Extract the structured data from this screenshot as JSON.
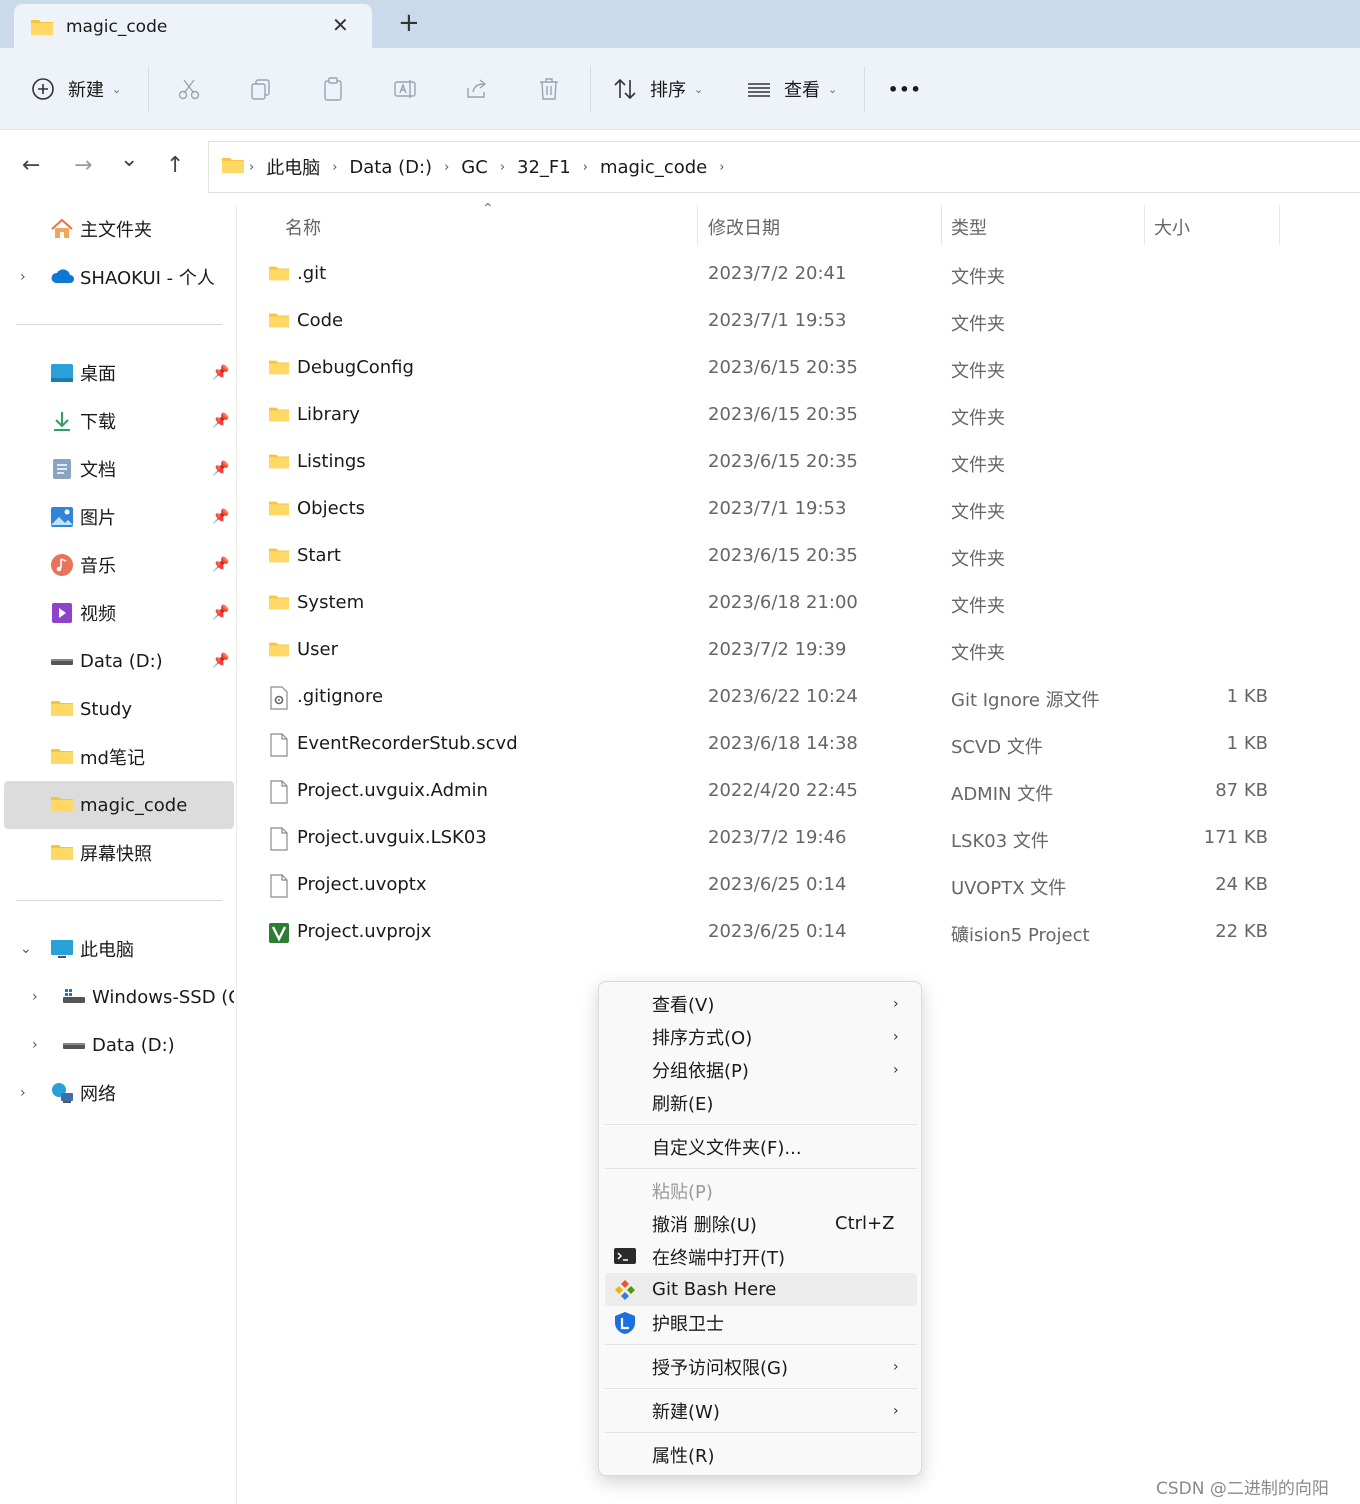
{
  "tab": {
    "title": "magic_code",
    "close_glyph": "✕",
    "new_tab_glyph": "+"
  },
  "toolbar": {
    "new_label": "新建",
    "sort_label": "排序",
    "view_label": "查看",
    "more_glyph": "•••"
  },
  "nav": {
    "back_glyph": "←",
    "forward_glyph": "→",
    "recent_glyph": "⌄",
    "up_glyph": "↑"
  },
  "breadcrumb": [
    "此电脑",
    "Data (D:)",
    "GC",
    "32_F1",
    "magic_code"
  ],
  "sidebar": {
    "home": "主文件夹",
    "onedrive": "SHAOKUI - 个人",
    "quick": [
      {
        "label": "桌面",
        "icon": "desktop-icon"
      },
      {
        "label": "下载",
        "icon": "download-icon"
      },
      {
        "label": "文档",
        "icon": "document-icon"
      },
      {
        "label": "图片",
        "icon": "pictures-icon"
      },
      {
        "label": "音乐",
        "icon": "music-icon"
      },
      {
        "label": "视频",
        "icon": "video-icon"
      },
      {
        "label": "Data (D:)",
        "icon": "drive-icon"
      },
      {
        "label": "Study",
        "icon": "folder-icon"
      },
      {
        "label": "md笔记",
        "icon": "folder-icon"
      },
      {
        "label": "magic_code",
        "icon": "folder-icon"
      },
      {
        "label": "屏幕快照",
        "icon": "folder-icon"
      }
    ],
    "this_pc": "此电脑",
    "drives": [
      "Windows-SSD (C",
      "Data (D:)"
    ],
    "network": "网络"
  },
  "columns": {
    "name": "名称",
    "date": "修改日期",
    "type": "类型",
    "size": "大小"
  },
  "files": [
    {
      "name": ".git",
      "date": "2023/7/2 20:41",
      "type": "文件夹",
      "size": "",
      "icon": "folder-icon"
    },
    {
      "name": "Code",
      "date": "2023/7/1 19:53",
      "type": "文件夹",
      "size": "",
      "icon": "folder-icon"
    },
    {
      "name": "DebugConfig",
      "date": "2023/6/15 20:35",
      "type": "文件夹",
      "size": "",
      "icon": "folder-icon"
    },
    {
      "name": "Library",
      "date": "2023/6/15 20:35",
      "type": "文件夹",
      "size": "",
      "icon": "folder-icon"
    },
    {
      "name": "Listings",
      "date": "2023/6/15 20:35",
      "type": "文件夹",
      "size": "",
      "icon": "folder-icon"
    },
    {
      "name": "Objects",
      "date": "2023/7/1 19:53",
      "type": "文件夹",
      "size": "",
      "icon": "folder-icon"
    },
    {
      "name": "Start",
      "date": "2023/6/15 20:35",
      "type": "文件夹",
      "size": "",
      "icon": "folder-icon"
    },
    {
      "name": "System",
      "date": "2023/6/18 21:00",
      "type": "文件夹",
      "size": "",
      "icon": "folder-icon"
    },
    {
      "name": "User",
      "date": "2023/7/2 19:39",
      "type": "文件夹",
      "size": "",
      "icon": "folder-icon"
    },
    {
      "name": ".gitignore",
      "date": "2023/6/22 10:24",
      "type": "Git Ignore 源文件",
      "size": "1 KB",
      "icon": "config-file-icon"
    },
    {
      "name": "EventRecorderStub.scvd",
      "date": "2023/6/18 14:38",
      "type": "SCVD 文件",
      "size": "1 KB",
      "icon": "file-icon"
    },
    {
      "name": "Project.uvguix.Admin",
      "date": "2022/4/20 22:45",
      "type": "ADMIN 文件",
      "size": "87 KB",
      "icon": "file-icon"
    },
    {
      "name": "Project.uvguix.LSK03",
      "date": "2023/7/2 19:46",
      "type": "LSK03 文件",
      "size": "171 KB",
      "icon": "file-icon"
    },
    {
      "name": "Project.uvoptx",
      "date": "2023/6/25 0:14",
      "type": "UVOPTX 文件",
      "size": "24 KB",
      "icon": "file-icon"
    },
    {
      "name": "Project.uvprojx",
      "date": "2023/6/25 0:14",
      "type": "礦ision5 Project",
      "size": "22 KB",
      "icon": "keil-project-icon"
    }
  ],
  "context_menu": {
    "view": "查看(V)",
    "sort": "排序方式(O)",
    "group": "分组依据(P)",
    "refresh": "刷新(E)",
    "customize": "自定义文件夹(F)...",
    "paste": "粘贴(P)",
    "undo": "撤消 删除(U)",
    "undo_shortcut": "Ctrl+Z",
    "terminal": "在终端中打开(T)",
    "git_bash": "Git Bash Here",
    "eye_guard": "护眼卫士",
    "grant_access": "授予访问权限(G)",
    "new": "新建(W)",
    "properties": "属性(R)"
  },
  "watermark": "CSDN @二进制的向阳",
  "colors": {
    "folder": "#f5c542",
    "accent": "#0067c0",
    "tabbar": "#cbdaeb",
    "toolbar": "#eef3f9"
  }
}
